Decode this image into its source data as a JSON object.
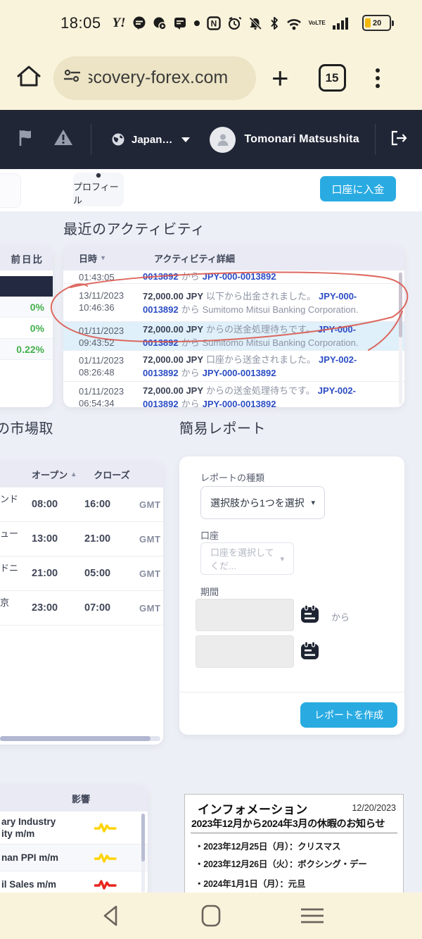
{
  "status_bar": {
    "time": "18:05",
    "battery_percent": "20",
    "volte_line1": "Vo",
    "volte_line2": "LTE",
    "nfc_letter": "N",
    "yahoo": "Y!"
  },
  "browser": {
    "url": "scovery-forex.com",
    "tab_count": "15"
  },
  "site_header": {
    "language": "Japan…",
    "user_name": "Tomonari Matsushita"
  },
  "toolbar": {
    "profile_tab": "プロフィール",
    "deposit_button": "口座に入金"
  },
  "rates_panel": {
    "change_header": "前日比",
    "values": [
      "0%",
      "0%",
      "0.22%"
    ]
  },
  "activity": {
    "title": "最近のアクティビティ",
    "col_datetime": "日時",
    "col_details": "アクティビティ詳細",
    "rows": [
      {
        "time": "01:43:05",
        "link1": "0013892",
        "mid": "から",
        "link2": "JPY-000-0013892",
        "end": "."
      },
      {
        "date": "13/11/2023",
        "time": "10:46:36",
        "amount": "72,000.00 JPY",
        "action": "以下から出金されました。",
        "link1": "JPY-000-0013892",
        "mid": "から",
        "dest": "Sumitomo Mitsui Banking Corporation."
      },
      {
        "date": "01/11/2023",
        "time": "09:43:52",
        "amount": "72,000.00 JPY",
        "action": "からの送金処理待ちです。",
        "link1": "JPY-000-0013892",
        "mid": "から",
        "dest": "Sumitomo Mitsui Banking Corporation."
      },
      {
        "date": "01/11/2023",
        "time": "08:26:48",
        "amount": "72,000.00 JPY",
        "action": "口座から送金されました。",
        "link1": "JPY-002-0013892",
        "mid": "から",
        "link2": "JPY-000-0013892",
        "end": "."
      },
      {
        "date": "01/11/2023",
        "time": "06:54:34",
        "amount": "72,000.00 JPY",
        "action": "からの送金処理待ちです。",
        "link1": "JPY-002-0013892",
        "mid": "から",
        "link2": "JPY-000-0013892",
        "end": "."
      }
    ]
  },
  "market_hours": {
    "title": "の市場取",
    "col_open": "オープン",
    "col_close": "クローズ",
    "rows": [
      {
        "city": "ンド",
        "open": "08:00",
        "close": "16:00",
        "tz": "GMT"
      },
      {
        "city": "ュー",
        "open": "13:00",
        "close": "21:00",
        "tz": "GMT"
      },
      {
        "city": "ドニ",
        "open": "21:00",
        "close": "05:00",
        "tz": "GMT"
      },
      {
        "city": "京",
        "open": "23:00",
        "close": "07:00",
        "tz": "GMT"
      }
    ]
  },
  "report": {
    "title": "簡易レポート",
    "type_label": "レポートの種類",
    "type_value": "選択肢から1つを選択",
    "account_label": "口座",
    "account_placeholder": "口座を選択してくだ...",
    "period_label": "期間",
    "from_label": "から",
    "submit_button": "レポートを作成"
  },
  "calendar": {
    "impact_header": "影響",
    "rows": [
      {
        "name_line1": "ary Industry",
        "name_line2": "ity m/m",
        "impact_color": "#ffd400"
      },
      {
        "name_line1": "nan PPI m/m",
        "name_line2": "",
        "impact_color": "#ffd400"
      },
      {
        "name_line1": "il Sales m/m",
        "name_line2": "",
        "impact_color": "#e8261d"
      }
    ]
  },
  "information": {
    "title": "インフォメーション",
    "date": "12/20/2023",
    "subtitle": "2023年12月から2024年3月の休暇のお知らせ",
    "items": [
      "・2023年12月25日（月）：クリスマス",
      "・2023年12月26日（火）：ボクシング・デー",
      "・2024年1月1日（月）：元旦"
    ]
  },
  "colors": {
    "accent_blue": "#29abe2",
    "link_blue": "#2b4cc4",
    "positive_green": "#43b04c",
    "annotation_red": "#d9594f",
    "highlight_row": "#dff0fa"
  }
}
